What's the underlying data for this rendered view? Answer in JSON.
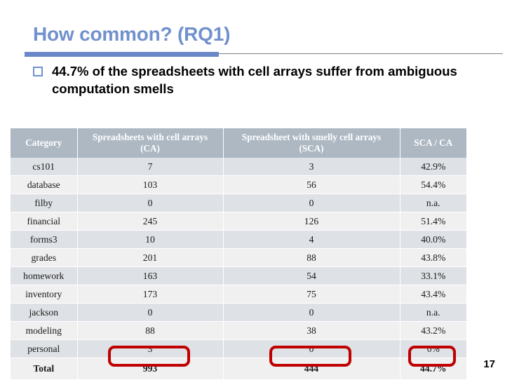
{
  "slide": {
    "title": "How common? (RQ1)",
    "bullet": "44.7% of the spreadsheets with cell arrays suffer from ambiguous computation smells",
    "bullet_marker_icon": "hollow-square-bullet-icon",
    "slide_number": "17",
    "accent_color": "#6c87c8",
    "title_color": "#7191cd",
    "highlight_color": "#c00000",
    "header_bg": "#adb8c3",
    "row_odd_bg": "#dee1e5",
    "row_even_bg": "#f0f0f1"
  },
  "chart_data": {
    "type": "table",
    "title": "How common? (RQ1)",
    "columns": [
      "Category",
      "Spreadsheets with cell arrays (CA)",
      "Spreadsheet with smelly cell arrays (SCA)",
      "SCA / CA"
    ],
    "rows": [
      {
        "category": "cs101",
        "ca": "7",
        "sca": "3",
        "ratio": "42.9%"
      },
      {
        "category": "database",
        "ca": "103",
        "sca": "56",
        "ratio": "54.4%"
      },
      {
        "category": "filby",
        "ca": "0",
        "sca": "0",
        "ratio": "n.a."
      },
      {
        "category": "financial",
        "ca": "245",
        "sca": "126",
        "ratio": "51.4%"
      },
      {
        "category": "forms3",
        "ca": "10",
        "sca": "4",
        "ratio": "40.0%"
      },
      {
        "category": "grades",
        "ca": "201",
        "sca": "88",
        "ratio": "43.8%"
      },
      {
        "category": "homework",
        "ca": "163",
        "sca": "54",
        "ratio": "33.1%"
      },
      {
        "category": "inventory",
        "ca": "173",
        "sca": "75",
        "ratio": "43.4%"
      },
      {
        "category": "jackson",
        "ca": "0",
        "sca": "0",
        "ratio": "n.a."
      },
      {
        "category": "modeling",
        "ca": "88",
        "sca": "38",
        "ratio": "43.2%"
      },
      {
        "category": "personal",
        "ca": "3",
        "sca": "0",
        "ratio": "0%"
      },
      {
        "category": "Total",
        "ca": "993",
        "sca": "444",
        "ratio": "44.7%"
      }
    ],
    "highlighted_cells": [
      "993",
      "444",
      "44.7%"
    ]
  },
  "table_header": {
    "col1": "Category",
    "col2_line1": "Spreadsheets with cell arrays",
    "col2_line2": "(CA)",
    "col3_line1": "Spreadsheet with smelly cell arrays",
    "col3_line2": "(SCA)",
    "col4": "SCA / CA"
  }
}
